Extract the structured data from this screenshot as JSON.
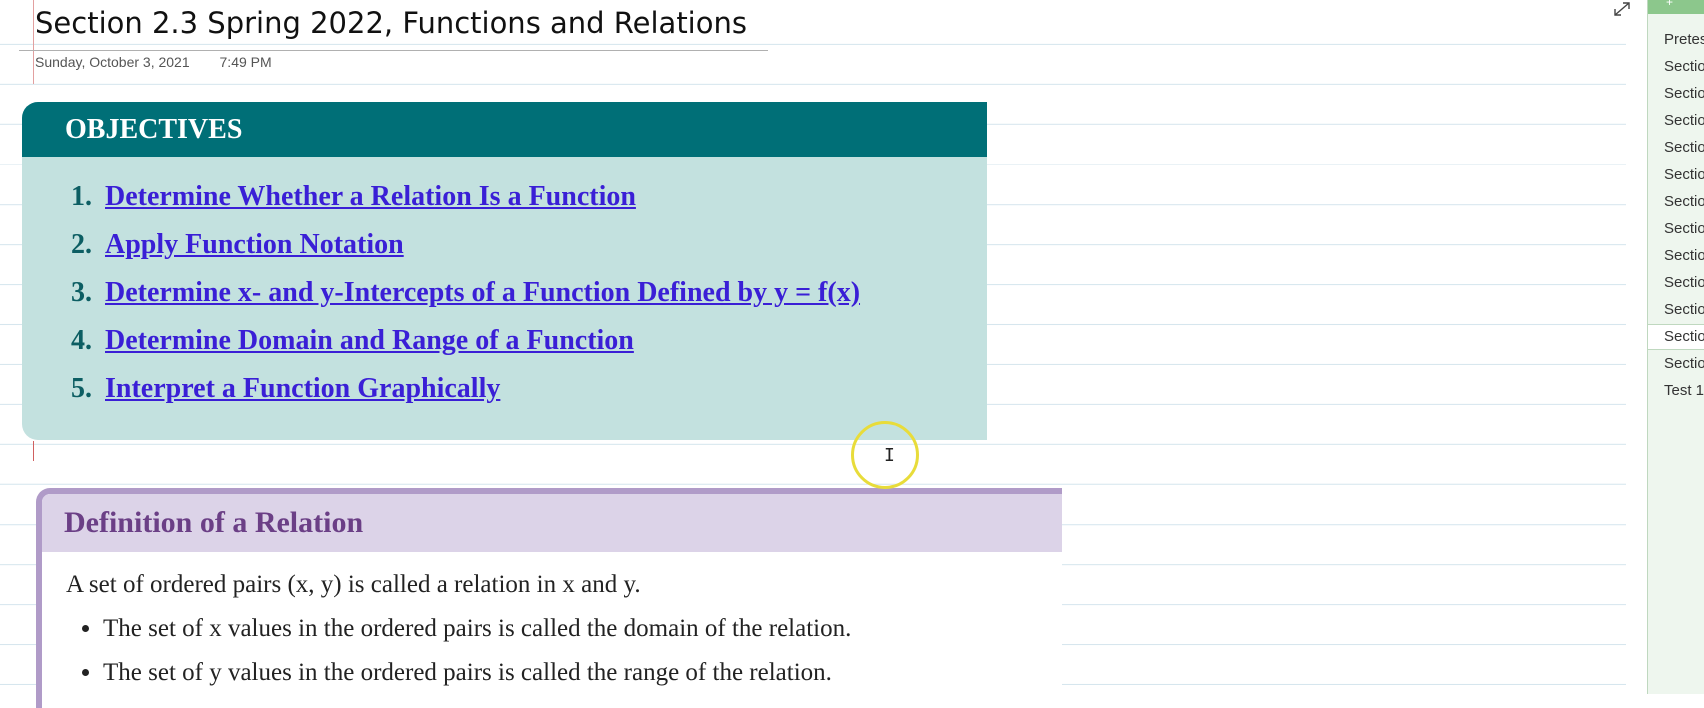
{
  "page": {
    "title": "Section 2.3 Spring 2022, Functions and Relations",
    "date": "Sunday, October 3, 2021",
    "time": "7:49 PM"
  },
  "objectives": {
    "heading": "OBJECTIVES",
    "items": [
      {
        "num": "1.",
        "text": "Determine Whether a Relation Is a Function"
      },
      {
        "num": "2.",
        "text": "Apply Function Notation"
      },
      {
        "num": "3.",
        "text": "Determine x- and y-Intercepts of a Function Defined by y = f(x)"
      },
      {
        "num": "4.",
        "text": "Determine Domain and Range of a Function"
      },
      {
        "num": "5.",
        "text": "Interpret a Function Graphically"
      }
    ]
  },
  "definition": {
    "heading": "Definition of a Relation",
    "intro": "A set of ordered pairs (x, y) is called a relation in x and y.",
    "bullets": [
      "The set of x values in the ordered pairs is called the domain of the relation.",
      "The set of y values in the ordered pairs is called the range of the relation."
    ]
  },
  "pages_panel": {
    "header_glyph": "+",
    "items": [
      "Pretes",
      "Sectio",
      "Sectio",
      "Sectio",
      "Sectio",
      "Sectio",
      "Sectio",
      "Sectio",
      "Sectio",
      "Sectio",
      "Sectio",
      "Sectio",
      "Sectio",
      "Test 1"
    ],
    "selected_index": 11
  },
  "colors": {
    "objectives_header": "#006f77",
    "objectives_body": "#c3e1df",
    "link": "#3a1fd6",
    "definition_border": "#b09bc8",
    "definition_header": "#dcd3e8",
    "highlight_ring": "#e8dc3a"
  },
  "icons": {
    "expand": "expand-diagonal-arrow-icon",
    "cursor": "text-ibeam-cursor-icon"
  }
}
